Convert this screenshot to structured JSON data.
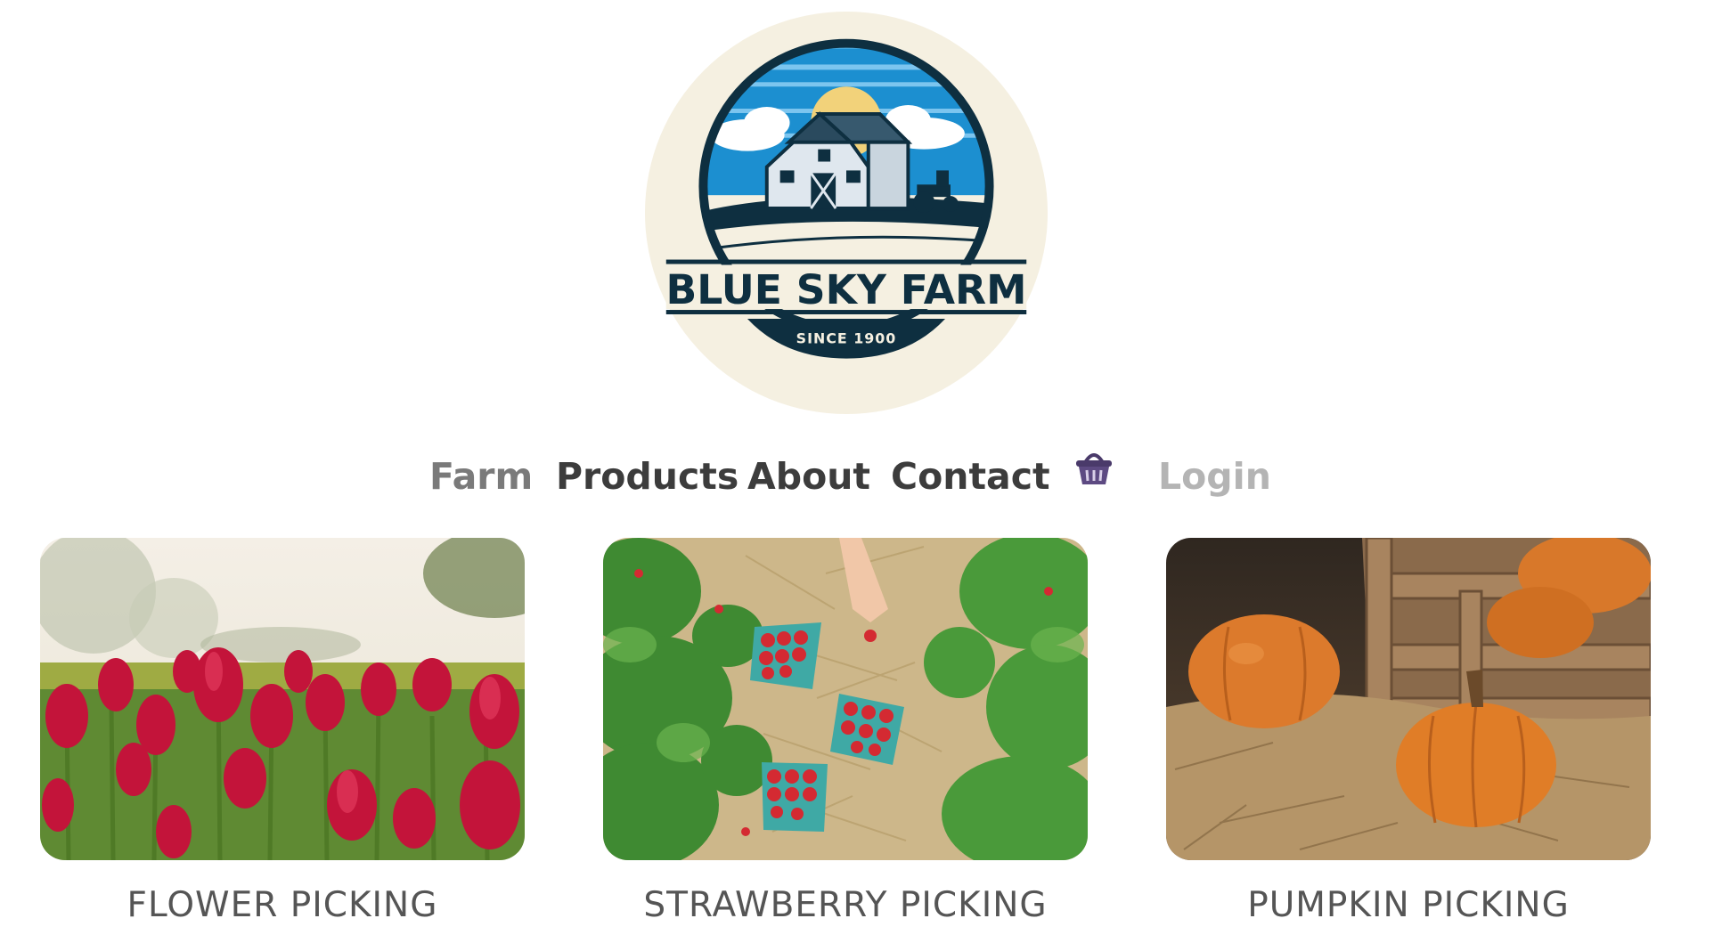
{
  "logo": {
    "name": "BLUE SKY FARM",
    "tagline": "SINCE 1900",
    "icon": "farm-barn-logo"
  },
  "nav": {
    "items": [
      {
        "label": "Farm"
      },
      {
        "label": "Products"
      },
      {
        "label": "About"
      },
      {
        "label": "Contact"
      }
    ],
    "cart_icon": "basket-icon",
    "login_label": "Login"
  },
  "cards": [
    {
      "label": "FLOWER PICKING",
      "image": "red-tulip-field"
    },
    {
      "label": "STRAWBERRY PICKING",
      "image": "strawberry-patch-with-baskets"
    },
    {
      "label": "PUMPKIN PICKING",
      "image": "pumpkins-in-crate-on-straw"
    }
  ],
  "colors": {
    "logo_badge_bg": "#f5f0e1",
    "logo_navy": "#0e2f40",
    "logo_sky": "#1c8fd0",
    "nav_text": "#3c3c3c",
    "nav_dim": "#7a7a7a",
    "nav_login": "#b4b4b4",
    "cart_icon": "#4a3a6a",
    "card_label": "#555555"
  }
}
